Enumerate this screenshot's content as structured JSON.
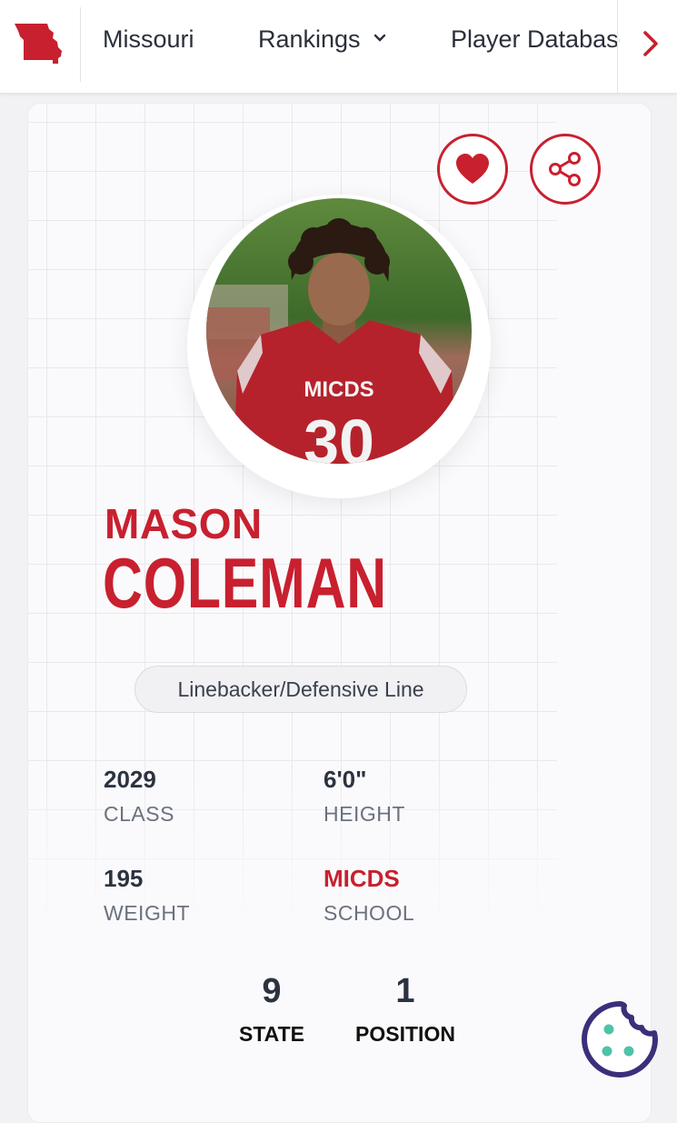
{
  "nav": {
    "state": "Missouri",
    "rankings": "Rankings",
    "player_database": "Player Database",
    "colors": {
      "brand_red": "#c8202f"
    }
  },
  "player": {
    "first_name": "MASON",
    "last_name": "COLEMAN",
    "position": "Linebacker/Defensive Line",
    "jersey_text": "MICDS",
    "jersey_number": "30",
    "stats": {
      "class_value": "2029",
      "class_label": "CLASS",
      "height_value": "6'0\"",
      "height_label": "HEIGHT",
      "weight_value": "195",
      "weight_label": "WEIGHT",
      "school_value": "MICDS",
      "school_label": "SCHOOL"
    },
    "rankings": {
      "state_value": "9",
      "state_label": "STATE",
      "position_value": "1",
      "position_label": "POSITION"
    }
  },
  "icons": [
    "missouri-logo-icon",
    "chevron-down-icon",
    "chevron-right-icon",
    "heart-icon",
    "share-icon",
    "cookie-icon"
  ]
}
